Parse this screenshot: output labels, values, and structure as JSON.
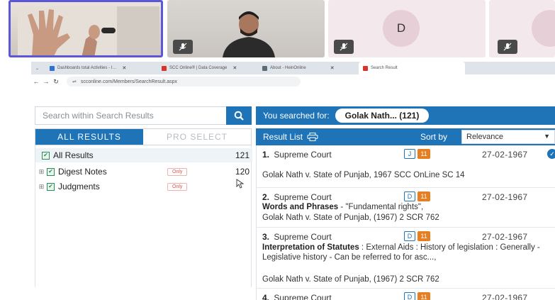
{
  "call": {
    "tiles": [
      {
        "id": "tile-1",
        "avatar_letter": ""
      },
      {
        "id": "tile-2",
        "avatar_letter": ""
      },
      {
        "id": "tile-3",
        "avatar_letter": "D"
      },
      {
        "id": "tile-4",
        "avatar_letter": ""
      }
    ]
  },
  "browser": {
    "tabs": [
      {
        "label": "Dashboards total Activities - I…",
        "favicon_color": "#2f6fd6"
      },
      {
        "label": "SCC Online® | Data Coverage",
        "favicon_color": "#d9342b"
      },
      {
        "label": "About - HeinOnline",
        "favicon_color": "#5a6b7a"
      },
      {
        "label": "Search Result",
        "favicon_color": "#d9342b"
      }
    ],
    "url": "scconline.com/Members/SearchResult.aspx"
  },
  "left_panel": {
    "search_placeholder": "Search within Search Results",
    "tabs": {
      "all_results": "ALL RESULTS",
      "pro_select": "PRO SELECT"
    },
    "tree": [
      {
        "label": "All Results",
        "count": "121"
      },
      {
        "label": "Digest Notes",
        "tag": "Only",
        "count": "120"
      },
      {
        "label": "Judgments",
        "tag": "Only",
        "count": ""
      }
    ]
  },
  "right_panel": {
    "searched_label": "You searched for:",
    "query": "Golak Nath... (121)",
    "result_list_label": "Result List",
    "sort_label": "Sort by",
    "sort_value": "Relevance",
    "results": [
      {
        "num": "1.",
        "court": "Supreme Court",
        "type_badge": "J",
        "count_badge": "11",
        "date": "27-02-1967",
        "verified": true,
        "lines": [
          "Golak Nath v. State of Punjab, 1967 SCC OnLine SC 14"
        ]
      },
      {
        "num": "2.",
        "court": "Supreme Court",
        "type_badge": "D",
        "count_badge": "11",
        "date": "27-02-1967",
        "bold": "Words and Phrases",
        "after_bold": " - \"Fundamental rights\",",
        "lines": [
          "Golak Nath v. State of Punjab, (1967) 2 SCR 762"
        ]
      },
      {
        "num": "3.",
        "court": "Supreme Court",
        "type_badge": "D",
        "count_badge": "11",
        "date": "27-02-1967",
        "bold": "Interpretation of Statutes",
        "after_bold": " : External Aids : History of legislation : Generally - Legislative history - Can be referred to for asc...,",
        "lines": [
          "Golak Nath v. State of Punjab, (1967) 2 SCR 762"
        ]
      },
      {
        "num": "4.",
        "court": "Supreme Court",
        "type_badge": "D",
        "count_badge": "11",
        "date": "27-02-1967"
      }
    ]
  },
  "colors": {
    "accent": "#1f73b7",
    "badge_orange": "#e67e22",
    "active_tile_border": "#5b57d6"
  }
}
